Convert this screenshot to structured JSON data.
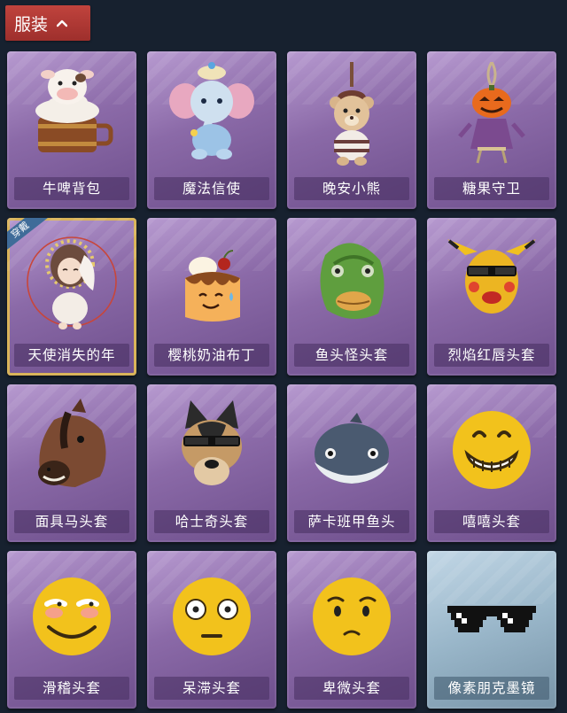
{
  "header": {
    "title": "服装",
    "toggle_icon": "chevron-up-icon"
  },
  "colors": {
    "background": "#17212f",
    "header": "#b13a36",
    "card_purple": "#8b6aa8",
    "card_blue": "#99b6c9",
    "selected_border": "#d9b45a"
  },
  "items": [
    {
      "label": "牛啤背包",
      "icon": "cow-beer-backpack-icon"
    },
    {
      "label": "魔法信使",
      "icon": "elephant-messenger-icon"
    },
    {
      "label": "晚安小熊",
      "icon": "bear-pendant-icon"
    },
    {
      "label": "糖果守卫",
      "icon": "pumpkin-guard-icon"
    },
    {
      "label": "天使消失的年",
      "icon": "angel-doll-icon",
      "badge": "穿戴"
    },
    {
      "label": "樱桃奶油布丁",
      "icon": "pudding-icon"
    },
    {
      "label": "鱼头怪头套",
      "icon": "fish-head-mask-icon"
    },
    {
      "label": "烈焰红唇头套",
      "icon": "yellow-mask-sunglasses-icon"
    },
    {
      "label": "面具马头套",
      "icon": "horse-mask-icon"
    },
    {
      "label": "哈士奇头套",
      "icon": "husky-mask-icon"
    },
    {
      "label": "萨卡班甲鱼头",
      "icon": "fish-round-head-icon"
    },
    {
      "label": "嘻嘻头套",
      "icon": "grin-emoji-icon"
    },
    {
      "label": "滑稽头套",
      "icon": "funny-emoji-icon"
    },
    {
      "label": "呆滞头套",
      "icon": "stunned-emoji-icon"
    },
    {
      "label": "卑微头套",
      "icon": "humble-emoji-icon"
    },
    {
      "label": "像素朋克墨镜",
      "icon": "pixel-sunglasses-icon"
    }
  ]
}
